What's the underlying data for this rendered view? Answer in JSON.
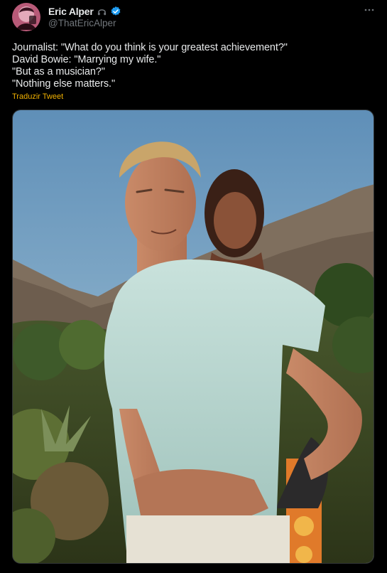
{
  "author": {
    "name": "Eric Alper",
    "handle": "@ThatEricAlper",
    "badges": [
      "music-note-icon",
      "verified-badge-icon"
    ],
    "avatar": "avatar"
  },
  "more_icon": "more-options-icon",
  "tweet": {
    "lines": [
      "Journalist: \"What do you think is your greatest achievement?\"",
      "David Bowie: \"Marrying my wife.\"",
      "\"But as a musician?\"",
      "\"Nothing else matters.\""
    ],
    "translate_label": "Traduzir Tweet"
  },
  "media": {
    "type": "photo",
    "subject": "photo"
  },
  "colors": {
    "background": "#000000",
    "text": "#e7e9ea",
    "secondary": "#71767b",
    "verified": "#1d9bf0",
    "translate": "#f0b000"
  }
}
